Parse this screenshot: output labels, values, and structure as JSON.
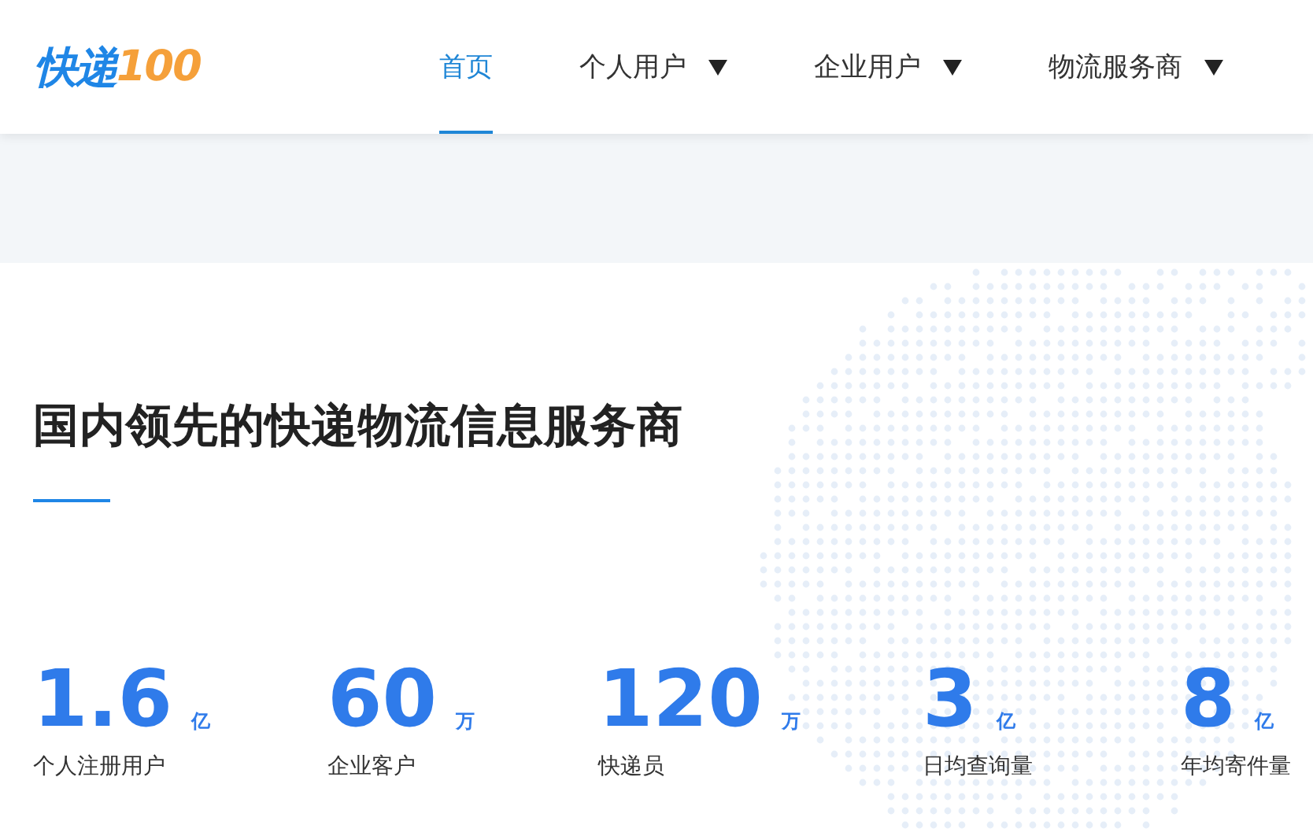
{
  "logo": {
    "part_1": "快递",
    "part_2": "100"
  },
  "nav": [
    {
      "label": "首页",
      "selected": true,
      "dropdown": false
    },
    {
      "label": "个人用户",
      "selected": false,
      "dropdown": true
    },
    {
      "label": "企业用户",
      "selected": false,
      "dropdown": true
    },
    {
      "label": "物流服务商",
      "selected": false,
      "dropdown": true
    }
  ],
  "heading": "国内领先的快递物流信息服务商",
  "stats": [
    {
      "value": "1.6",
      "unit": "亿",
      "label": "个人注册用户"
    },
    {
      "value": "60",
      "unit": "万",
      "label": "企业客户"
    },
    {
      "value": "120",
      "unit": "万",
      "label": "快递员"
    },
    {
      "value": "3",
      "unit": "亿",
      "label": "日均查询量"
    },
    {
      "value": "8",
      "unit": "亿",
      "label": "年均寄件量"
    }
  ]
}
